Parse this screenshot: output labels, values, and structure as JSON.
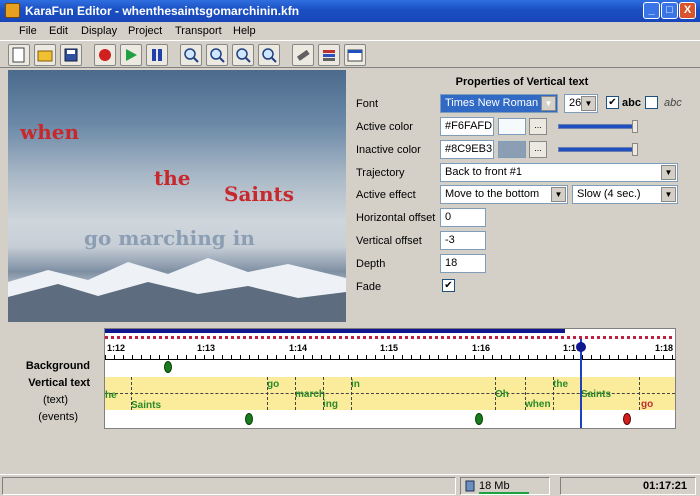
{
  "window": {
    "title": "KaraFun Editor - whenthesaintsgomarchinin.kfn",
    "minimize": "_",
    "maximize": "□",
    "close": "X"
  },
  "menu": [
    "File",
    "Edit",
    "Display",
    "Project",
    "Transport",
    "Help"
  ],
  "toolbar_icons": [
    "new-icon",
    "open-icon",
    "save-icon",
    "record-icon",
    "play-icon",
    "pause-icon",
    "zoom-in-icon",
    "zoom-in-icon",
    "zoom-out-icon",
    "zoom-fit-icon",
    "tool-icon",
    "layers-icon",
    "properties-icon"
  ],
  "preview": {
    "lyrics": [
      {
        "text": "when",
        "color": "#C8282C"
      },
      {
        "text": "the",
        "color": "#C8282C"
      },
      {
        "text": "Saints",
        "color": "#C8282C"
      },
      {
        "text": "go marching in",
        "color": "#8C9EB3"
      }
    ]
  },
  "properties": {
    "title": "Properties of Vertical text",
    "font_label": "Font",
    "font_value": "Times New Roman",
    "size_value": "26",
    "style_abc": "abc",
    "style_italic": "abc",
    "active_color_label": "Active color",
    "active_color_value": "#F6FAFD",
    "inactive_color_label": "Inactive color",
    "inactive_color_value": "#8C9EB3",
    "trajectory_label": "Trajectory",
    "trajectory_value": "Back to front #1",
    "active_effect_label": "Active effect",
    "active_effect_value": "Move to the bottom",
    "speed_value": "Slow (4 sec.)",
    "hoffset_label": "Horizontal offset",
    "hoffset_value": "0",
    "voffset_label": "Vertical offset",
    "voffset_value": "-3",
    "depth_label": "Depth",
    "depth_value": "18",
    "fade_label": "Fade",
    "dots": "..."
  },
  "timeline": {
    "labels": {
      "background": "Background",
      "vertical_text": "Vertical text",
      "text": "(text)",
      "events": "(events)"
    },
    "ticks": [
      "1:12",
      "1:13",
      "1:14",
      "1:15",
      "1:16",
      "1:17",
      "1:18"
    ],
    "words": [
      "he",
      "Saints",
      "go",
      "march",
      "ing",
      "in",
      "Oh",
      "when",
      "the",
      "Saints",
      "go"
    ]
  },
  "status": {
    "memory": "18 Mb",
    "time": "01:17:21"
  }
}
